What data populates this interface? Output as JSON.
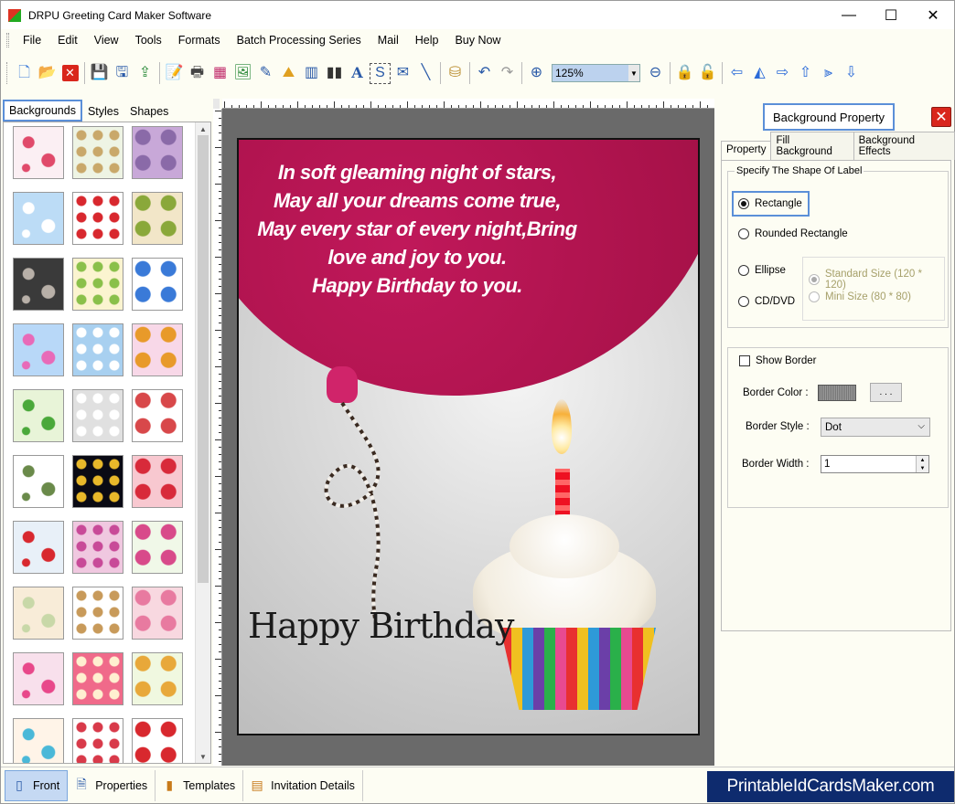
{
  "window": {
    "title": "DRPU Greeting Card Maker Software",
    "minimize": "—",
    "maximize": "☐",
    "close": "✕"
  },
  "menu": [
    "File",
    "Edit",
    "View",
    "Tools",
    "Formats",
    "Batch Processing Series",
    "Mail",
    "Help",
    "Buy Now"
  ],
  "toolbar": {
    "icons": [
      "new-icon",
      "open-icon",
      "close-doc-icon",
      "save-icon",
      "save-as-icon",
      "export-icon",
      "properties-icon",
      "print-icon",
      "print-preview-icon",
      "image-icon",
      "pencil-icon",
      "shape-icon",
      "barcode-icon",
      "barcode2-icon",
      "text-icon",
      "signature-icon",
      "mail-icon",
      "line-icon",
      "database-icon",
      "undo-icon",
      "redo-icon",
      "zoom-in-icon",
      "zoom-out-icon",
      "lock-icon",
      "unlock-icon",
      "arrow-left-icon",
      "flip-icon",
      "arrow-right-icon",
      "arrow-up-icon",
      "align-icon",
      "arrow-down-icon"
    ],
    "zoom_value": "125%"
  },
  "left_tabs": [
    "Backgrounds",
    "Styles",
    "Shapes"
  ],
  "thumbnails": [
    {
      "name": "bg-thumb-1",
      "c1": "#fbeff3",
      "c2": "#e04a6a"
    },
    {
      "name": "bg-thumb-2",
      "c1": "#eef4e4",
      "c2": "#c9a86a"
    },
    {
      "name": "bg-thumb-3",
      "c1": "#c8a8d8",
      "c2": "#8a6aa8"
    },
    {
      "name": "bg-thumb-4",
      "c1": "#bcdcf6",
      "c2": "#ffffff"
    },
    {
      "name": "bg-thumb-5",
      "c1": "#ffffff",
      "c2": "#d8282e"
    },
    {
      "name": "bg-thumb-6",
      "c1": "#f2e6c8",
      "c2": "#8aa83a"
    },
    {
      "name": "bg-thumb-7",
      "c1": "#3a3a3a",
      "c2": "#b8b0a8"
    },
    {
      "name": "bg-thumb-8",
      "c1": "#fbf4d0",
      "c2": "#8ac04a"
    },
    {
      "name": "bg-thumb-9",
      "c1": "#ffffff",
      "c2": "#3a7ad8"
    },
    {
      "name": "bg-thumb-10",
      "c1": "#b8d8f8",
      "c2": "#e86ab8"
    },
    {
      "name": "bg-thumb-11",
      "c1": "#a8d0f0",
      "c2": "#ffffff"
    },
    {
      "name": "bg-thumb-12",
      "c1": "#f8d8e8",
      "c2": "#e89a2a"
    },
    {
      "name": "bg-thumb-13",
      "c1": "#e8f4d8",
      "c2": "#4aa83a"
    },
    {
      "name": "bg-thumb-14",
      "c1": "#e0e0e0",
      "c2": "#ffffff"
    },
    {
      "name": "bg-thumb-15",
      "c1": "#ffffff",
      "c2": "#d8484a"
    },
    {
      "name": "bg-thumb-16",
      "c1": "#ffffff",
      "c2": "#6a8a4a"
    },
    {
      "name": "bg-thumb-17",
      "c1": "#0a0a14",
      "c2": "#e8b82a"
    },
    {
      "name": "bg-thumb-18",
      "c1": "#f8c8d0",
      "c2": "#d82a3a"
    },
    {
      "name": "bg-thumb-19",
      "c1": "#e8f0f8",
      "c2": "#d8282e"
    },
    {
      "name": "bg-thumb-20",
      "c1": "#f0c8e0",
      "c2": "#c84a98"
    },
    {
      "name": "bg-thumb-21",
      "c1": "#f0f8e8",
      "c2": "#d84a8a"
    },
    {
      "name": "bg-thumb-22",
      "c1": "#f8ecd8",
      "c2": "#c8d8a8"
    },
    {
      "name": "bg-thumb-23",
      "c1": "#ffffff",
      "c2": "#c89a5a"
    },
    {
      "name": "bg-thumb-24",
      "c1": "#f8d8e0",
      "c2": "#e87aa0"
    },
    {
      "name": "bg-thumb-25",
      "c1": "#f8e0ec",
      "c2": "#e8488a"
    },
    {
      "name": "bg-thumb-26",
      "c1": "#f06a8a",
      "c2": "#fff0d0"
    },
    {
      "name": "bg-thumb-27",
      "c1": "#f0f8e0",
      "c2": "#e8a83a"
    },
    {
      "name": "bg-thumb-28",
      "c1": "#fff4e8",
      "c2": "#4ab8d8"
    },
    {
      "name": "bg-thumb-29",
      "c1": "#ffffff",
      "c2": "#d83a4a"
    },
    {
      "name": "bg-thumb-30",
      "c1": "#ffffff",
      "c2": "#d8282e"
    }
  ],
  "card": {
    "verse": [
      "In soft gleaming night of stars,",
      "May all your dreams come true,",
      "May every star of every night,Bring",
      "love and joy to you.",
      "Happy Birthday to you."
    ],
    "script_text": "Happy Birthday"
  },
  "right_panel": {
    "title": "Background Property",
    "tabs": [
      "Property",
      "Fill Background",
      "Background Effects"
    ],
    "shape_group_label": "Specify The Shape Of Label",
    "shapes": [
      "Rectangle",
      "Rounded Rectangle",
      "Ellipse",
      "CD/DVD"
    ],
    "selected_shape": "Rectangle",
    "sizes": [
      "Standard Size (120 * 120)",
      "Mini Size (80 * 80)"
    ],
    "show_border_label": "Show Border",
    "show_border_checked": false,
    "border_color_label": "Border Color :",
    "border_color_button": ". . .",
    "border_style_label": "Border Style :",
    "border_style_value": "Dot",
    "border_width_label": "Border Width :",
    "border_width_value": "1"
  },
  "status_tabs": [
    "Front",
    "Properties",
    "Templates",
    "Invitation Details"
  ],
  "brand": "PrintableIdCardsMaker.com",
  "colors": {
    "accent_outline": "#5b8fd8",
    "balloon": "#a9124a",
    "brand_bg": "#0e2b6e",
    "close_red": "#d9261c"
  }
}
